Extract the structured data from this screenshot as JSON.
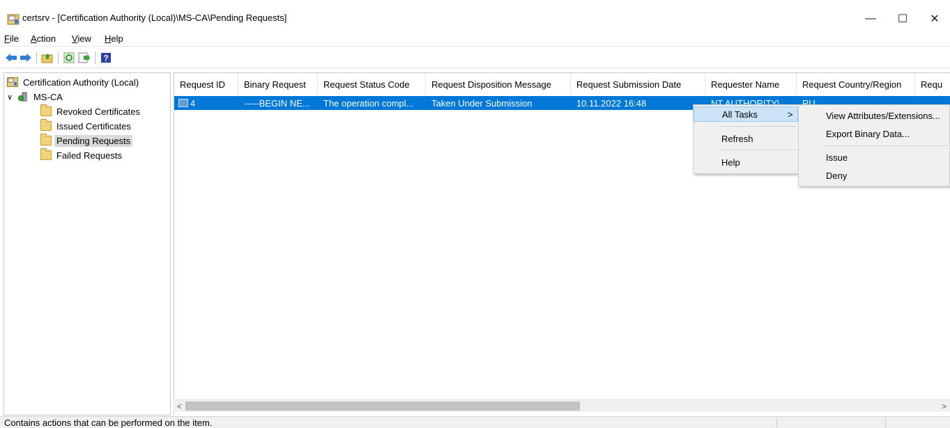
{
  "window": {
    "title": "certsrv - [Certification Authority (Local)\\MS-CA\\Pending Requests]",
    "controls": {
      "minimize": "—",
      "maximize": "☐",
      "close": "✕"
    }
  },
  "menubar": {
    "items": [
      {
        "label": "File",
        "accel": "F",
        "rest": "ile"
      },
      {
        "label": "Action",
        "accel": "A",
        "rest": "ction"
      },
      {
        "label": "View",
        "accel": "V",
        "rest": "iew"
      },
      {
        "label": "Help",
        "accel": "H",
        "rest": "elp"
      }
    ]
  },
  "toolbar": {
    "icons": [
      "back-icon",
      "forward-icon",
      "up-folder-icon",
      "refresh-icon",
      "export-list-icon",
      "help-icon"
    ],
    "help_glyph": "?"
  },
  "tree": {
    "root": "Certification Authority (Local)",
    "ca": "MS-CA",
    "expander": "∨",
    "folders": [
      {
        "label": "Revoked Certificates",
        "selected": false
      },
      {
        "label": "Issued Certificates",
        "selected": false
      },
      {
        "label": "Pending Requests",
        "selected": true
      },
      {
        "label": "Failed Requests",
        "selected": false
      }
    ]
  },
  "list": {
    "columns": [
      "Request ID",
      "Binary Request",
      "Request Status Code",
      "Request Disposition Message",
      "Request Submission Date",
      "Requester Name",
      "Request Country/Region",
      "Requ"
    ],
    "rows": [
      {
        "request_id": "4",
        "binary_request": "-----BEGIN NE...",
        "status_code": "The operation compl...",
        "disposition": "Taken Under Submission",
        "submission_date": "10.11.2022 16:48",
        "requester": "NT AUTHORITY\\",
        "country": "RU",
        "selected": true
      }
    ],
    "selection_color": "#0078d7"
  },
  "scrollbar": {
    "left_arrow": "<",
    "right_arrow": ">"
  },
  "context_menu": {
    "items": [
      {
        "label": "All Tasks",
        "submenu_arrow": ">",
        "highlighted": true
      },
      {
        "label": "Refresh"
      },
      {
        "label": "Help"
      }
    ]
  },
  "submenu": {
    "items": [
      "View Attributes/Extensions...",
      "Export Binary Data...",
      "Issue",
      "Deny"
    ]
  },
  "statusbar": {
    "text": "Contains actions that can be performed on the item."
  }
}
